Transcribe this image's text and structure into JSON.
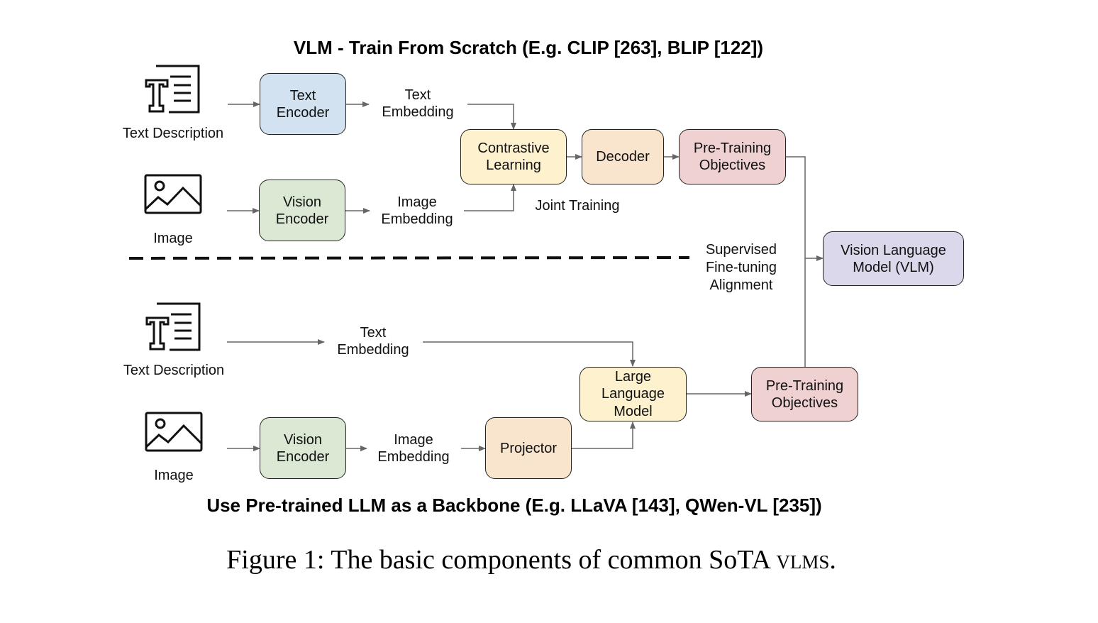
{
  "top_section": {
    "title": "VLM - Train From Scratch (E.g. CLIP [263], BLIP [122])",
    "inputs": {
      "text_description": "Text Description",
      "image": "Image"
    },
    "boxes": {
      "text_encoder": "Text\nEncoder",
      "vision_encoder": "Vision\nEncoder",
      "contrastive_learning": "Contrastive\nLearning",
      "decoder": "Decoder",
      "pretraining_objectives": "Pre-Training\nObjectives"
    },
    "labels": {
      "text_embedding": "Text\nEmbedding",
      "image_embedding": "Image\nEmbedding",
      "joint_training": "Joint Training"
    }
  },
  "middle": {
    "alignment_label": "Supervised\nFine-tuning\nAlignment",
    "vlm_box": "Vision Language\nModel (VLM)"
  },
  "bottom_section": {
    "title": "Use Pre-trained LLM as a Backbone (E.g. LLaVA [143], QWen-VL [235])",
    "inputs": {
      "text_description": "Text Description",
      "image": "Image"
    },
    "boxes": {
      "vision_encoder": "Vision\nEncoder",
      "projector": "Projector",
      "llm": "Large\nLanguage\nModel",
      "pretraining_objectives": "Pre-Training\nObjectives"
    },
    "labels": {
      "text_embedding": "Text\nEmbedding",
      "image_embedding": "Image\nEmbedding"
    }
  },
  "caption": {
    "prefix": "Figure 1: The basic components of common SoTA ",
    "smallcaps": "vlms",
    "suffix": "."
  },
  "colors": {
    "encoder_text": "#d3e2f1",
    "encoder_vision": "#dbe8d4",
    "contrastive": "#fdf2cd",
    "decoder": "#f9e5cd",
    "pretraining": "#efd1d1",
    "vlm": "#dcd8ec",
    "llm": "#fdf2cd",
    "projector": "#f9e5cd",
    "arrow": "#666666"
  }
}
